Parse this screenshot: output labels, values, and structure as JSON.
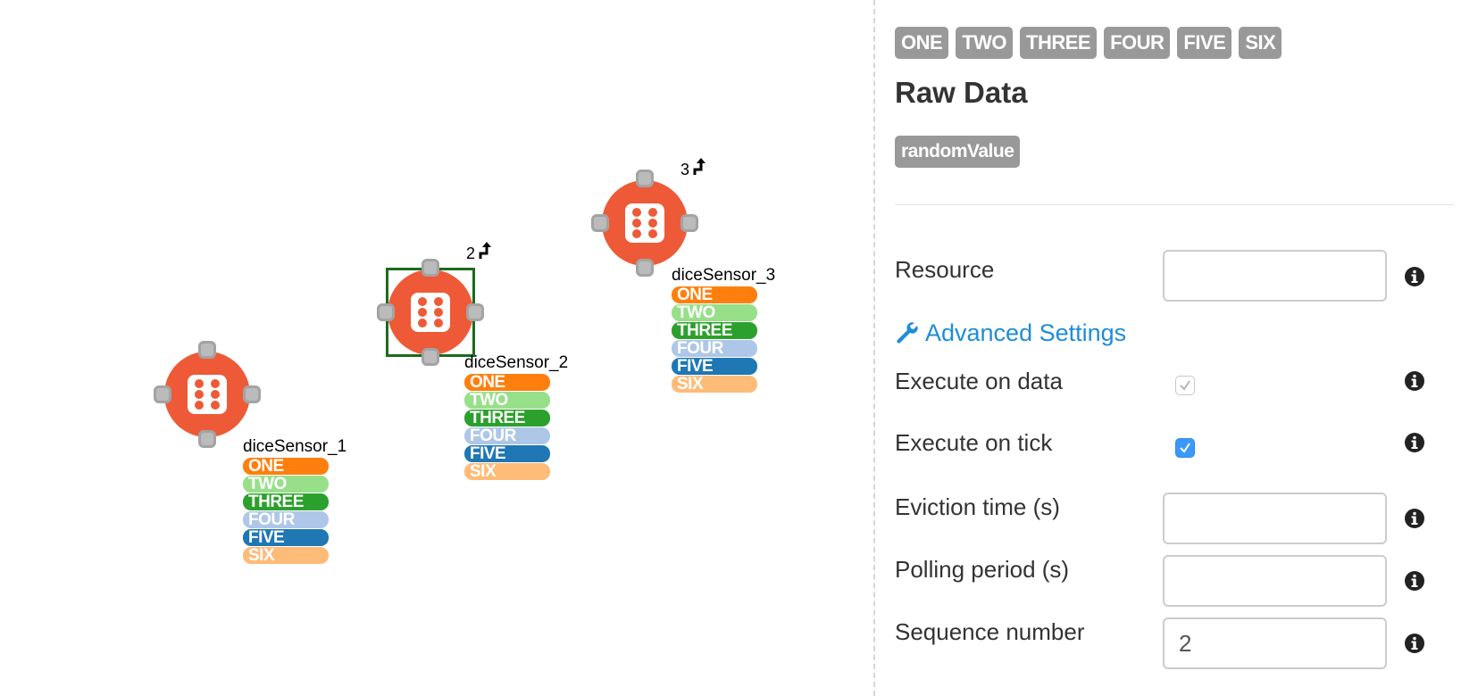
{
  "canvas": {
    "nodes": [
      {
        "name": "diceSensor_1",
        "sequence": "",
        "selected": false,
        "outputs": [
          "ONE",
          "TWO",
          "THREE",
          "FOUR",
          "FIVE",
          "SIX"
        ]
      },
      {
        "name": "diceSensor_2",
        "sequence": "2",
        "selected": true,
        "outputs": [
          "ONE",
          "TWO",
          "THREE",
          "FOUR",
          "FIVE",
          "SIX"
        ]
      },
      {
        "name": "diceSensor_3",
        "sequence": "3",
        "selected": false,
        "outputs": [
          "ONE",
          "TWO",
          "THREE",
          "FOUR",
          "FIVE",
          "SIX"
        ]
      }
    ],
    "output_colors": [
      "#ff7f0e",
      "#98df8a",
      "#2ca02c",
      "#aec7e8",
      "#1f77b4",
      "#ffbb78"
    ],
    "node_color": "#ee5a37",
    "selection_color": "#1c6b1c"
  },
  "panel": {
    "output_badges": [
      "ONE",
      "TWO",
      "THREE",
      "FOUR",
      "FIVE",
      "SIX"
    ],
    "raw_title": "Raw Data",
    "raw_badge": "randomValue",
    "resource_label": "Resource",
    "resource_value": "",
    "advanced_link": "Advanced Settings",
    "execute_on_data_label": "Execute on data",
    "execute_on_data": true,
    "execute_on_data_enabled": false,
    "execute_on_tick_label": "Execute on tick",
    "execute_on_tick": true,
    "eviction_label": "Eviction time (s)",
    "eviction_value": "",
    "polling_label": "Polling period (s)",
    "polling_value": "",
    "sequence_label": "Sequence number",
    "sequence_value": "2",
    "link_color": "#1f8dd6",
    "badge_color": "#999999"
  }
}
